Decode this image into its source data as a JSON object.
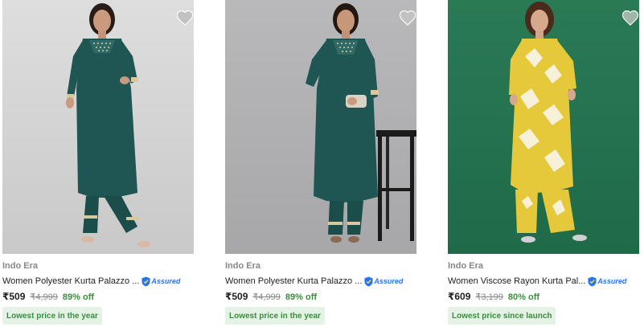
{
  "products": [
    {
      "brand": "Indo Era",
      "title": "Women Polyester Kurta Palazzo ...",
      "assured": "Assured",
      "price": "₹509",
      "mrp": "₹4,999",
      "discount": "89% off",
      "tag": "Lowest price in the year",
      "image_alt": "Woman in teal kurta and palazzo set",
      "wishlist_icon": "heart-icon"
    },
    {
      "brand": "Indo Era",
      "title": "Women Polyester Kurta Palazzo ...",
      "assured": "Assured",
      "price": "₹509",
      "mrp": "₹4,999",
      "discount": "89% off",
      "tag": "Lowest price in the year",
      "image_alt": "Woman in teal kurta holding clutch beside stool",
      "wishlist_icon": "heart-icon"
    },
    {
      "brand": "Indo Era",
      "title": "Women Viscose Rayon Kurta Pal...",
      "assured": "Assured",
      "price": "₹609",
      "mrp": "₹3,199",
      "discount": "80% off",
      "tag": "Lowest price since launch",
      "image_alt": "Woman in yellow ikat kurta set on green background",
      "wishlist_icon": "heart-icon"
    }
  ],
  "colors": {
    "discount_green": "#388e3c",
    "tag_bg": "#e4f3e6",
    "assured_blue": "#2874f0",
    "muted_text": "#878787"
  }
}
